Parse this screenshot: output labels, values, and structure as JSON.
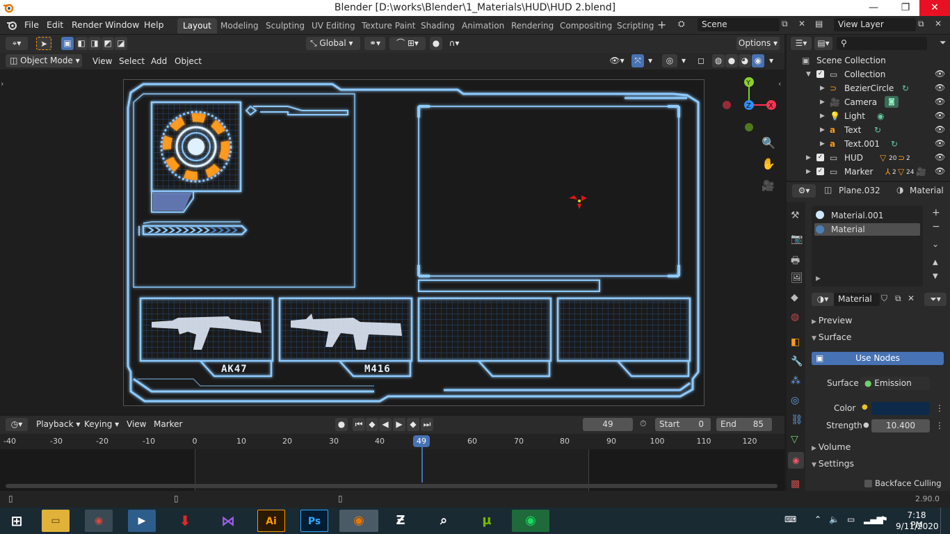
{
  "window": {
    "title": "Blender [D:\\works\\Blender\\1_Materials\\HUD\\HUD 2.blend]"
  },
  "menus": [
    "File",
    "Edit",
    "Render",
    "Window",
    "Help"
  ],
  "workspaces": [
    "Layout",
    "Modeling",
    "Sculpting",
    "UV Editing",
    "Texture Paint",
    "Shading",
    "Animation",
    "Rendering",
    "Compositing",
    "Scripting"
  ],
  "scene": "Scene",
  "view_layer": "View Layer",
  "toolbar": {
    "orientation": "Global",
    "options": "Options"
  },
  "viewport_header": {
    "mode": "Object Mode",
    "menus": [
      "View",
      "Select",
      "Add",
      "Object"
    ]
  },
  "hud": {
    "weapon1": "AK47",
    "weapon2": "M416"
  },
  "timeline": {
    "menus": [
      "Playback",
      "Keying",
      "View",
      "Marker"
    ],
    "current_frame": "49",
    "start_label": "Start",
    "start": "0",
    "end_label": "End",
    "end": "85",
    "ticks": [
      "-40",
      "-30",
      "-20",
      "-10",
      "0",
      "10",
      "20",
      "30",
      "40",
      "49",
      "60",
      "70",
      "80",
      "90",
      "100",
      "110",
      "120"
    ],
    "playhead": "49"
  },
  "outliner": {
    "root": "Scene Collection",
    "items": [
      {
        "label": "Collection"
      },
      {
        "label": "BezierCircle"
      },
      {
        "label": "Camera"
      },
      {
        "label": "Light"
      },
      {
        "label": "Text"
      },
      {
        "label": "Text.001"
      },
      {
        "label": "HUD",
        "badge1": "20",
        "badge2": "2"
      },
      {
        "label": "Marker",
        "badge1": "2",
        "badge2": "24"
      }
    ]
  },
  "properties": {
    "object": "Plane.032",
    "tab": "Material",
    "slots": [
      "Material.001",
      "Material"
    ],
    "material_name": "Material",
    "sections": {
      "preview": "Preview",
      "surface": "Surface",
      "volume": "Volume",
      "settings": "Settings"
    },
    "use_nodes": "Use Nodes",
    "surface_label": "Surface",
    "surface_value": "Emission",
    "color_label": "Color",
    "color_value": "#0e2a4a",
    "strength_label": "Strength",
    "strength_value": "10.400",
    "backface": "Backface Culling"
  },
  "status": {
    "version": "2.90.0"
  },
  "taskbar": {
    "time": "7:18 PM",
    "date": "9/11/2020"
  },
  "colors": {
    "hud_blue": "#7ec8ff",
    "accent": "#4772b3",
    "orange": "#ff9a1a",
    "playhead": "#4772b3"
  }
}
